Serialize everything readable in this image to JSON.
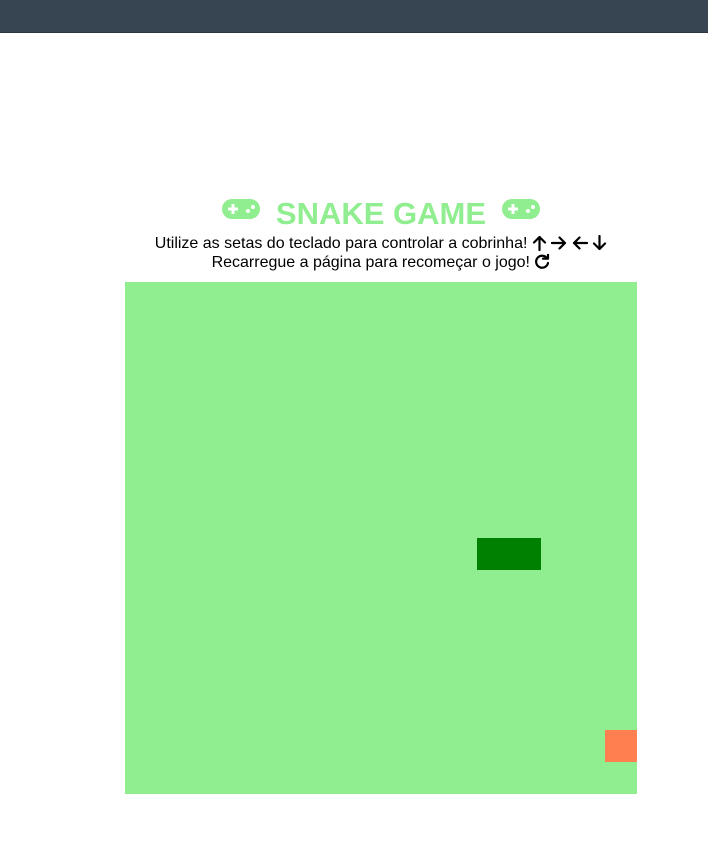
{
  "header": {
    "title": "SNAKE GAME"
  },
  "instructions": {
    "line1": "Utilize as setas do teclado para controlar a cobrinha!",
    "line2": "Recarregue a página para recomeçar o jogo!"
  },
  "icons": {
    "title_left": "gamepad-icon",
    "title_right": "gamepad-icon",
    "arrows": [
      "arrow-up-icon",
      "arrow-right-icon",
      "arrow-left-icon",
      "arrow-down-icon"
    ],
    "reload": "reload-icon"
  },
  "colors": {
    "board": "#90ee90",
    "title": "#90ee90",
    "snake": "#008000",
    "food": "#ff7f50",
    "topbar": "#374451"
  },
  "game": {
    "grid_cols": 16,
    "grid_rows": 16,
    "snake": [
      {
        "col": 11,
        "row": 8
      },
      {
        "col": 12,
        "row": 8
      }
    ],
    "food": {
      "col": 15,
      "row": 14
    }
  }
}
